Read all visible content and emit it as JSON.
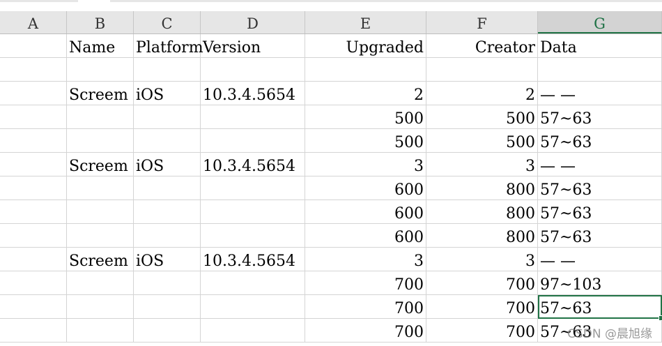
{
  "colors": {
    "header_bg": "#e6e6e6",
    "selected_header_text": "#1e7145",
    "selection_border": "#217346",
    "gridline": "#d4d4d4"
  },
  "column_headers": [
    "A",
    "B",
    "C",
    "D",
    "E",
    "F",
    "G"
  ],
  "selected_column": "G",
  "rows": [
    [
      "",
      "Name",
      "Platform",
      "Version",
      "Upgraded",
      "Creator",
      "Data"
    ],
    [
      "",
      "",
      "",
      "",
      "",
      "",
      ""
    ],
    [
      "",
      "Screem",
      "iOS",
      "10.3.4.5654",
      "2",
      "2",
      "— —"
    ],
    [
      "",
      "",
      "",
      "",
      "500",
      "500",
      "57~63"
    ],
    [
      "",
      "",
      "",
      "",
      "500",
      "500",
      "57~63"
    ],
    [
      "",
      "Screem",
      "iOS",
      "10.3.4.5654",
      "3",
      "3",
      "— —"
    ],
    [
      "",
      "",
      "",
      "",
      "600",
      "800",
      "57~63"
    ],
    [
      "",
      "",
      "",
      "",
      "600",
      "800",
      "57~63"
    ],
    [
      "",
      "",
      "",
      "",
      "600",
      "800",
      "57~63"
    ],
    [
      "",
      "Screem",
      "iOS",
      "10.3.4.5654",
      "3",
      "3",
      "— —"
    ],
    [
      "",
      "",
      "",
      "",
      "700",
      "700",
      "97~103"
    ],
    [
      "",
      "",
      "",
      "",
      "700",
      "700",
      "57~63"
    ],
    [
      "",
      "",
      "",
      "",
      "700",
      "700",
      "57~63"
    ]
  ],
  "active_cell": "G12",
  "watermark": "CSDN @晨旭缘"
}
